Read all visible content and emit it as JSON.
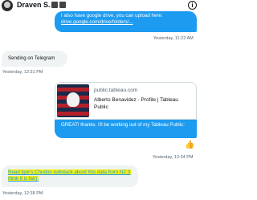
{
  "header": {
    "name": "Draven S.",
    "badge_icons": [
      "emoji-icon",
      "emoji-icon"
    ],
    "info_icon": "info-icon"
  },
  "messages": {
    "m1": {
      "line1": "I also have google drive, you can upload here:",
      "link": "drive.google.com/drive/folders/...",
      "time": "Yesterday, 11:22 AM"
    },
    "m2": {
      "text": "Sending on Telegram",
      "time": "Yesterday, 12:31 PM"
    },
    "card": {
      "domain": "public.tableau.com",
      "title": "Alberto Benavidez - Profile | Tableau Public"
    },
    "m3": {
      "text": "GREAT! thanks.  I'll be working out of my Tableau Public:"
    },
    "reaction": {
      "emoji": "👍",
      "time": "Yesterday, 12:34 PM"
    },
    "m4": {
      "text": "Read Igor's Chudov substack about this data from NZ (I think it is fair).",
      "time": "Yesterday, 12:38 PM"
    }
  }
}
